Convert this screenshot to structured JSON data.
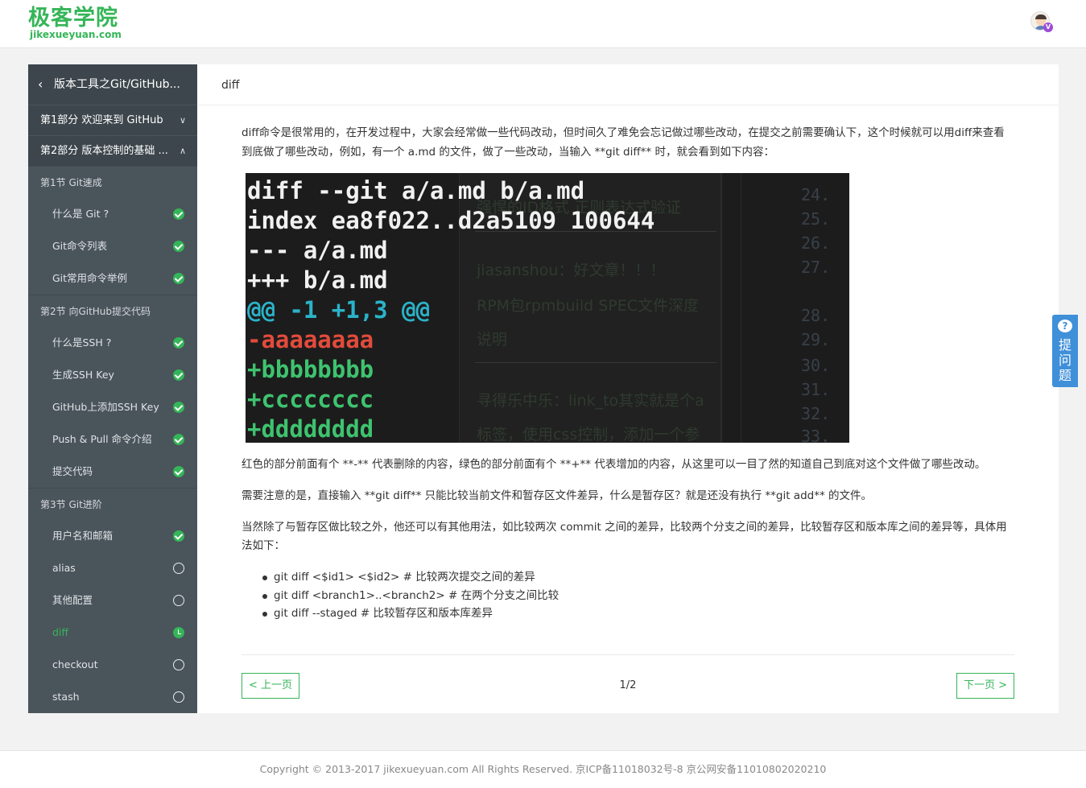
{
  "header": {
    "logo_cn": "极客学院",
    "logo_en": "jikexueyuan.com",
    "avatar_icon": "user-avatar-icon",
    "vip_badge": "V"
  },
  "sidebar": {
    "course_title": "版本工具之Git/GitHub...",
    "back_icon": "‹",
    "parts": [
      {
        "label": "第1部分 欢迎来到 GitHub",
        "chevron": "∨"
      },
      {
        "label": "第2部分 版本控制的基础 ...",
        "chevron": "∧"
      }
    ],
    "sections": [
      {
        "label": "第1节 Git速成"
      },
      {
        "label": "第2节 向GitHub提交代码"
      },
      {
        "label": "第3节 Git进阶"
      }
    ],
    "lessons": [
      {
        "label": "什么是 Git ?",
        "status": "done"
      },
      {
        "label": "Git命令列表",
        "status": "done"
      },
      {
        "label": "Git常用命令举例",
        "status": "done"
      },
      {
        "label": "什么是SSH ?",
        "status": "done"
      },
      {
        "label": "生成SSH Key",
        "status": "done"
      },
      {
        "label": "GitHub上添加SSH Key",
        "status": "done"
      },
      {
        "label": "Push & Pull 命令介绍",
        "status": "done"
      },
      {
        "label": "提交代码",
        "status": "done"
      },
      {
        "label": "用户名和邮箱",
        "status": "done"
      },
      {
        "label": "alias",
        "status": "todo"
      },
      {
        "label": "其他配置",
        "status": "todo"
      },
      {
        "label": "diff",
        "status": "current"
      },
      {
        "label": "checkout",
        "status": "todo"
      },
      {
        "label": "stash",
        "status": "todo"
      }
    ],
    "collapse_icon": "«"
  },
  "main": {
    "title": "diff",
    "intro": "diff命令是很常用的，在开发过程中，大家会经常做一些代码改动，但时间久了难免会忘记做过哪些改动，在提交之前需要确认下，这个时候就可以用diff来查看到底做了哪些改动，例如，有一个 a.md 的文件，做了一些改动，当输入 **git diff** 时，就会看到如下内容：",
    "screenshot": {
      "code_lines": [
        {
          "text": "diff --git a/a.md b/a.md",
          "color": "#f1f1f1"
        },
        {
          "text": "index ea8f022..d2a5109 100644",
          "color": "#f1f1f1"
        },
        {
          "text": "--- a/a.md",
          "color": "#f1f1f1"
        },
        {
          "text": "+++ b/a.md",
          "color": "#f1f1f1"
        },
        {
          "text": "@@ -1 +1,3 @@",
          "color": "#2bb3c9"
        },
        {
          "text": "-aaaaaaaa",
          "color": "#e24b3b"
        },
        {
          "text": "+bbbbbbbb",
          "color": "#3ec36f"
        },
        {
          "text": "+cccccccc",
          "color": "#3ec36f"
        },
        {
          "text": "+dddddddd",
          "color": "#3ec36f"
        }
      ],
      "background_texts": [
        "强悍的ID格式 正则表达式验证",
        "jiasanshou：好文章！！！",
        "RPM包rpmbuild SPEC文件深度",
        "说明",
        "寻得乐中乐：link_to其实就是个a",
        "标签，使用css控制，添加一个参"
      ],
      "line_numbers": [
        "24.",
        "25.",
        "26.",
        "27.",
        "28.",
        "29.",
        "30.",
        "31.",
        "32.",
        "33."
      ]
    },
    "paragraphs": [
      "红色的部分前面有个 **-** 代表删除的内容，绿色的部分前面有个 **+** 代表增加的内容，从这里可以一目了然的知道自己到底对这个文件做了哪些改动。",
      "需要注意的是，直接输入 **git diff** 只能比较当前文件和暂存区文件差异，什么是暂存区？就是还没有执行 **git add** 的文件。",
      "当然除了与暂存区做比较之外，他还可以有其他用法，如比较两次 commit 之间的差异，比较两个分支之间的差异，比较暂存区和版本库之间的差异等，具体用法如下："
    ],
    "bullets": [
      "git diff <$id1> <$id2>   # 比较两次提交之间的差异",
      "git diff <branch1>..<branch2> # 在两个分支之间比较",
      "git diff --staged   # 比较暂存区和版本库差异"
    ],
    "prev_label": "< 上一页",
    "next_label": "下一页 >",
    "page_indicator": "1/2"
  },
  "ask_button": {
    "label": "提问题",
    "icon": "question-bubble-icon",
    "glyph": "?"
  },
  "footer": {
    "text": "Copyright © 2013-2017 jikexueyuan.com All Rights Reserved. 京ICP备11018032号-8 京公网安备11010802020210"
  }
}
